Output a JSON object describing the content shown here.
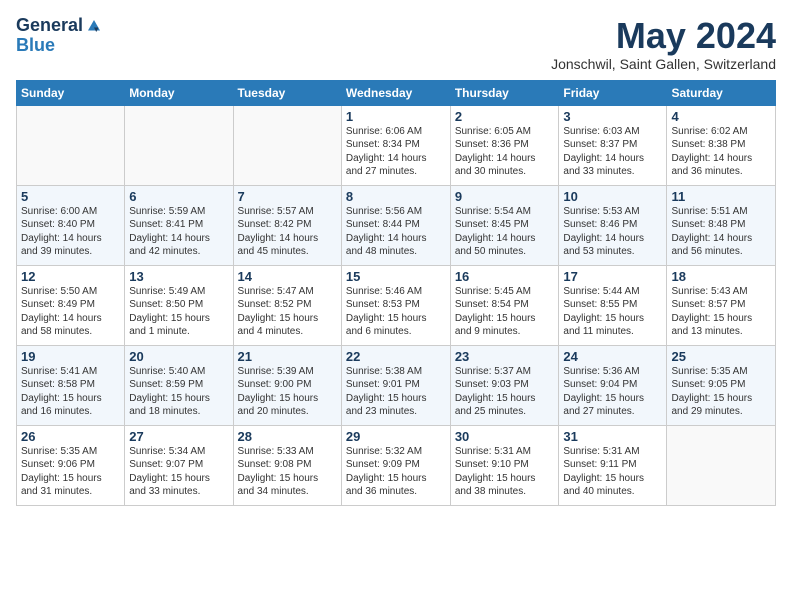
{
  "logo": {
    "line1": "General",
    "line2": "Blue"
  },
  "title": "May 2024",
  "subtitle": "Jonschwil, Saint Gallen, Switzerland",
  "days_of_week": [
    "Sunday",
    "Monday",
    "Tuesday",
    "Wednesday",
    "Thursday",
    "Friday",
    "Saturday"
  ],
  "weeks": [
    [
      {
        "day": "",
        "info": ""
      },
      {
        "day": "",
        "info": ""
      },
      {
        "day": "",
        "info": ""
      },
      {
        "day": "1",
        "info": "Sunrise: 6:06 AM\nSunset: 8:34 PM\nDaylight: 14 hours\nand 27 minutes."
      },
      {
        "day": "2",
        "info": "Sunrise: 6:05 AM\nSunset: 8:36 PM\nDaylight: 14 hours\nand 30 minutes."
      },
      {
        "day": "3",
        "info": "Sunrise: 6:03 AM\nSunset: 8:37 PM\nDaylight: 14 hours\nand 33 minutes."
      },
      {
        "day": "4",
        "info": "Sunrise: 6:02 AM\nSunset: 8:38 PM\nDaylight: 14 hours\nand 36 minutes."
      }
    ],
    [
      {
        "day": "5",
        "info": "Sunrise: 6:00 AM\nSunset: 8:40 PM\nDaylight: 14 hours\nand 39 minutes."
      },
      {
        "day": "6",
        "info": "Sunrise: 5:59 AM\nSunset: 8:41 PM\nDaylight: 14 hours\nand 42 minutes."
      },
      {
        "day": "7",
        "info": "Sunrise: 5:57 AM\nSunset: 8:42 PM\nDaylight: 14 hours\nand 45 minutes."
      },
      {
        "day": "8",
        "info": "Sunrise: 5:56 AM\nSunset: 8:44 PM\nDaylight: 14 hours\nand 48 minutes."
      },
      {
        "day": "9",
        "info": "Sunrise: 5:54 AM\nSunset: 8:45 PM\nDaylight: 14 hours\nand 50 minutes."
      },
      {
        "day": "10",
        "info": "Sunrise: 5:53 AM\nSunset: 8:46 PM\nDaylight: 14 hours\nand 53 minutes."
      },
      {
        "day": "11",
        "info": "Sunrise: 5:51 AM\nSunset: 8:48 PM\nDaylight: 14 hours\nand 56 minutes."
      }
    ],
    [
      {
        "day": "12",
        "info": "Sunrise: 5:50 AM\nSunset: 8:49 PM\nDaylight: 14 hours\nand 58 minutes."
      },
      {
        "day": "13",
        "info": "Sunrise: 5:49 AM\nSunset: 8:50 PM\nDaylight: 15 hours\nand 1 minute."
      },
      {
        "day": "14",
        "info": "Sunrise: 5:47 AM\nSunset: 8:52 PM\nDaylight: 15 hours\nand 4 minutes."
      },
      {
        "day": "15",
        "info": "Sunrise: 5:46 AM\nSunset: 8:53 PM\nDaylight: 15 hours\nand 6 minutes."
      },
      {
        "day": "16",
        "info": "Sunrise: 5:45 AM\nSunset: 8:54 PM\nDaylight: 15 hours\nand 9 minutes."
      },
      {
        "day": "17",
        "info": "Sunrise: 5:44 AM\nSunset: 8:55 PM\nDaylight: 15 hours\nand 11 minutes."
      },
      {
        "day": "18",
        "info": "Sunrise: 5:43 AM\nSunset: 8:57 PM\nDaylight: 15 hours\nand 13 minutes."
      }
    ],
    [
      {
        "day": "19",
        "info": "Sunrise: 5:41 AM\nSunset: 8:58 PM\nDaylight: 15 hours\nand 16 minutes."
      },
      {
        "day": "20",
        "info": "Sunrise: 5:40 AM\nSunset: 8:59 PM\nDaylight: 15 hours\nand 18 minutes."
      },
      {
        "day": "21",
        "info": "Sunrise: 5:39 AM\nSunset: 9:00 PM\nDaylight: 15 hours\nand 20 minutes."
      },
      {
        "day": "22",
        "info": "Sunrise: 5:38 AM\nSunset: 9:01 PM\nDaylight: 15 hours\nand 23 minutes."
      },
      {
        "day": "23",
        "info": "Sunrise: 5:37 AM\nSunset: 9:03 PM\nDaylight: 15 hours\nand 25 minutes."
      },
      {
        "day": "24",
        "info": "Sunrise: 5:36 AM\nSunset: 9:04 PM\nDaylight: 15 hours\nand 27 minutes."
      },
      {
        "day": "25",
        "info": "Sunrise: 5:35 AM\nSunset: 9:05 PM\nDaylight: 15 hours\nand 29 minutes."
      }
    ],
    [
      {
        "day": "26",
        "info": "Sunrise: 5:35 AM\nSunset: 9:06 PM\nDaylight: 15 hours\nand 31 minutes."
      },
      {
        "day": "27",
        "info": "Sunrise: 5:34 AM\nSunset: 9:07 PM\nDaylight: 15 hours\nand 33 minutes."
      },
      {
        "day": "28",
        "info": "Sunrise: 5:33 AM\nSunset: 9:08 PM\nDaylight: 15 hours\nand 34 minutes."
      },
      {
        "day": "29",
        "info": "Sunrise: 5:32 AM\nSunset: 9:09 PM\nDaylight: 15 hours\nand 36 minutes."
      },
      {
        "day": "30",
        "info": "Sunrise: 5:31 AM\nSunset: 9:10 PM\nDaylight: 15 hours\nand 38 minutes."
      },
      {
        "day": "31",
        "info": "Sunrise: 5:31 AM\nSunset: 9:11 PM\nDaylight: 15 hours\nand 40 minutes."
      },
      {
        "day": "",
        "info": ""
      }
    ]
  ]
}
